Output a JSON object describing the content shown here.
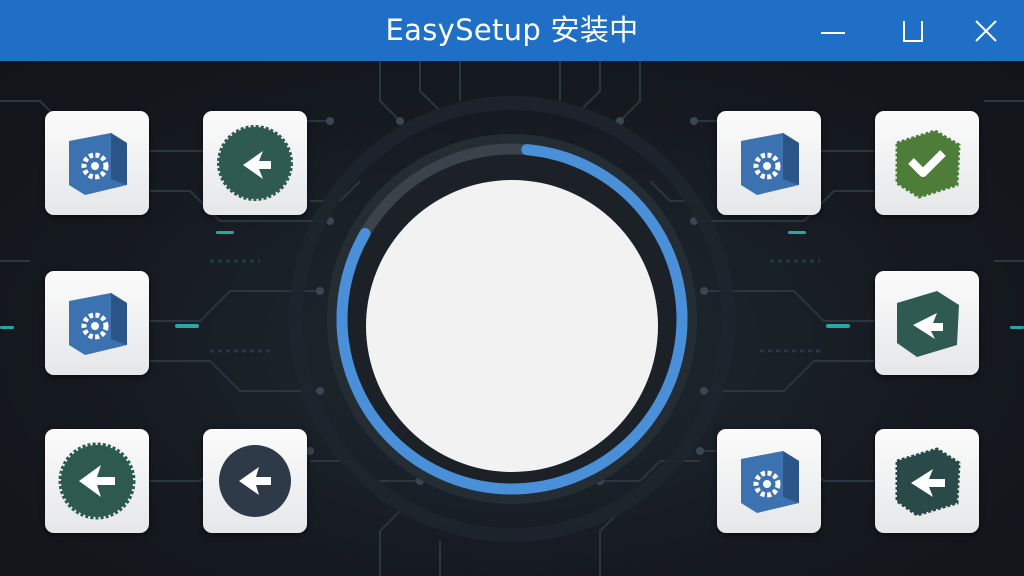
{
  "window": {
    "title": "EasySetup 安装中",
    "controls": {
      "minimize": "minimize-icon",
      "maximize": "maximize-icon",
      "close": "close-icon"
    }
  },
  "colors": {
    "titlebar": "#1f6fc6",
    "background": "#15191f",
    "progress_arc": "#4a90d9",
    "circuit_glow": "#2fd4d8",
    "package_blue": "#3d72b0",
    "badge_green": "#4e7d3a",
    "badge_teal": "#2f5a52",
    "badge_slate": "#2f3a48"
  },
  "progress": {
    "value_fraction": 0.82
  },
  "icons": [
    {
      "id": "tile-left-1",
      "icon": "gear-package-icon"
    },
    {
      "id": "tile-left-2",
      "icon": "back-arrow-badge-icon"
    },
    {
      "id": "tile-left-3",
      "icon": "gear-package-icon"
    },
    {
      "id": "tile-left-4",
      "icon": "back-arrow-badge-icon"
    },
    {
      "id": "tile-left-5",
      "icon": "back-arrow-badge-icon"
    },
    {
      "id": "tile-right-1",
      "icon": "gear-package-icon"
    },
    {
      "id": "tile-right-2",
      "icon": "checkmark-package-icon"
    },
    {
      "id": "tile-right-3",
      "icon": "arrow-package-icon"
    },
    {
      "id": "tile-right-4",
      "icon": "gear-package-icon"
    },
    {
      "id": "tile-right-5",
      "icon": "back-arrow-package-icon"
    }
  ]
}
